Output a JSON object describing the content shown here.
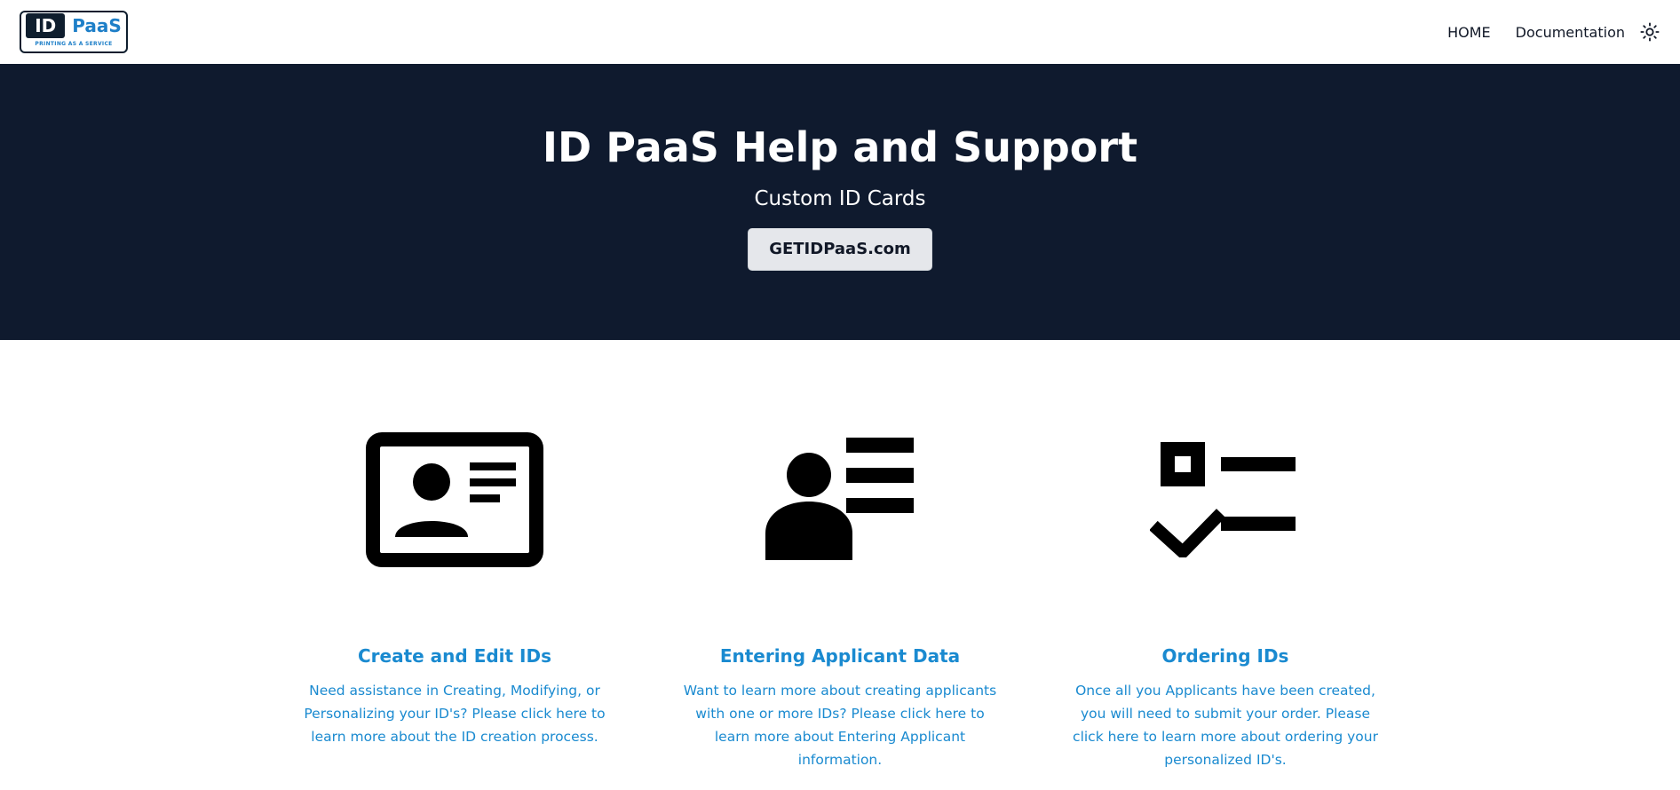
{
  "nav": {
    "logo": {
      "id_text": "ID",
      "paas_text": "PaaS",
      "tagline": "PRINTING AS A SERVICE"
    },
    "links": [
      {
        "label": "HOME"
      },
      {
        "label": "Documentation"
      }
    ],
    "theme_icon": "sun-icon"
  },
  "hero": {
    "title": "ID PaaS Help and Support",
    "subtitle": "Custom ID Cards",
    "button_label": "GETIDPaaS.com"
  },
  "features": [
    {
      "icon": "id-card-icon",
      "title": "Create and Edit IDs",
      "description": "Need assistance in Creating, Modifying, or Personalizing your ID's? Please click here to learn more about the ID creation process."
    },
    {
      "icon": "applicant-data-icon",
      "title": "Entering Applicant Data",
      "description": "Want to learn more about creating applicants with one or more IDs? Please click here to learn more about Entering Applicant information."
    },
    {
      "icon": "checklist-icon",
      "title": "Ordering IDs",
      "description": "Once all you Applicants have been created, you will need to submit your order. Please click here to learn more about ordering your personalized ID's."
    }
  ],
  "colors": {
    "hero_background": "#0f1a2e",
    "accent_blue": "#1a8ad0",
    "logo_dark": "#0f1e2e",
    "logo_blue": "#1e7fc8"
  }
}
